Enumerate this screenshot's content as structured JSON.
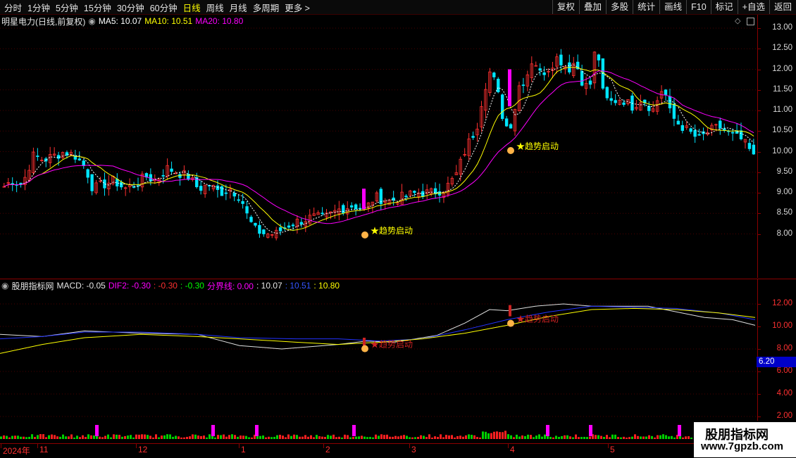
{
  "toolbar": {
    "periods": [
      "分时",
      "1分钟",
      "5分钟",
      "15分钟",
      "30分钟",
      "60分钟",
      "日线",
      "周线",
      "月线",
      "多周期",
      "更多 >"
    ],
    "active_period": "日线",
    "actions": [
      "复权",
      "叠加",
      "多股",
      "统计",
      "画线",
      "F10",
      "标记",
      "+自选",
      "返回"
    ]
  },
  "main": {
    "stock_name": "明星电力(日线,前复权)",
    "ma5": "MA5: 10.07",
    "ma10": "MA10: 10.51",
    "ma20": "MA20: 10.80",
    "axis_ticks": [
      "13.00",
      "12.50",
      "12.00",
      "11.50",
      "11.00",
      "10.50",
      "10.00",
      "9.50",
      "9.00",
      "8.50",
      "8.00"
    ],
    "signal_label": "趋势启动",
    "colors": {
      "up": "#ff3030",
      "down": "#00ffff",
      "ma5": "#ffffff",
      "ma10": "#ffff00",
      "ma20": "#ff00ff"
    }
  },
  "indicator": {
    "name": "股朋指标网",
    "macd": "MACD: -0.05",
    "dif2": "DIF2: -0.30",
    "v1": ": -0.30",
    "v2": ": -0.30",
    "fenjie": "分界线: 0.00",
    "v3": ": 10.07",
    "v4": ": 10.51",
    "v5": ": 10.80",
    "axis_ticks": [
      "12.00",
      "10.00",
      "8.00",
      "6.00",
      "4.00",
      "2.00"
    ],
    "highlight_value": "6.20",
    "signal_label": "趋势启动"
  },
  "dates": [
    "2024年",
    "11",
    "12",
    "1",
    "2",
    "3",
    "4",
    "5"
  ],
  "watermark": {
    "line1": "股朋指标网",
    "line2": "www.7gpzb.com"
  }
}
